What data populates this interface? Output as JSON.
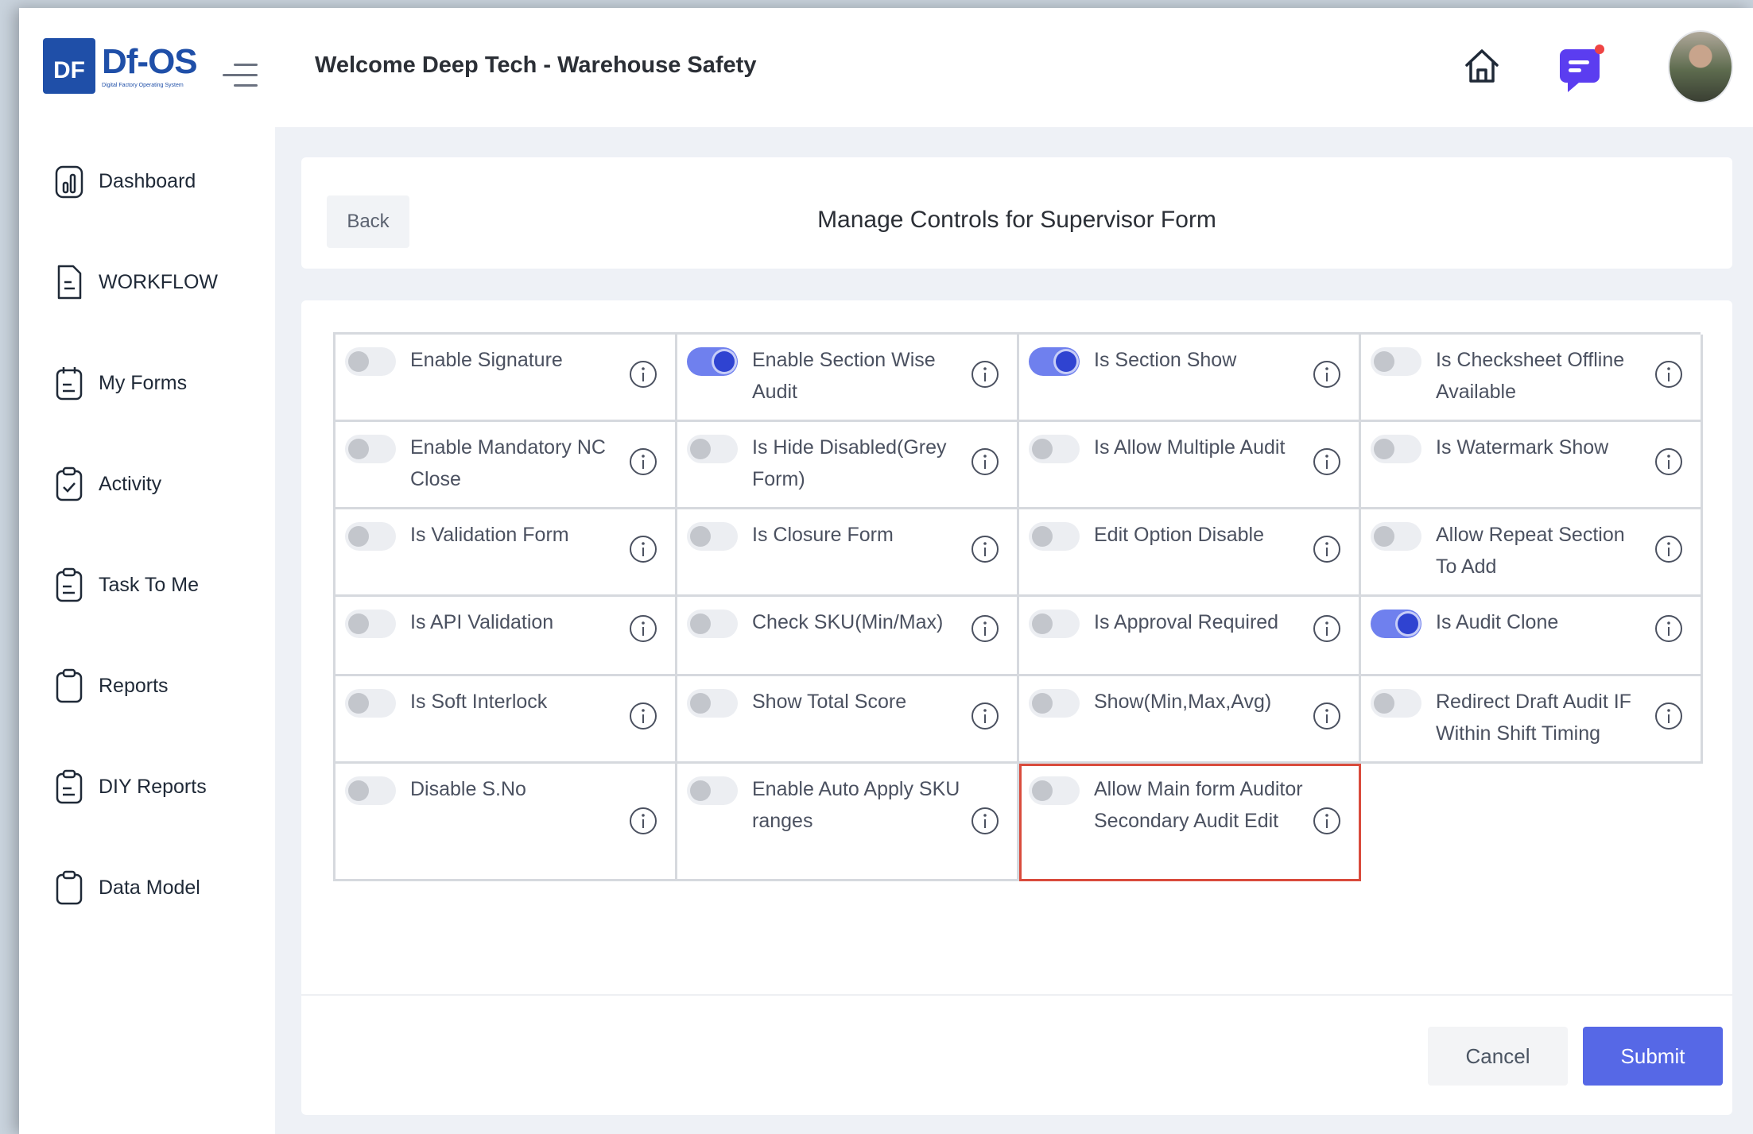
{
  "brand": {
    "logo_mark": "DF",
    "name": "Df-OS",
    "tagline": "Digital Factory Operating System",
    "color": "#1f4fa8"
  },
  "header": {
    "welcome": "Welcome Deep Tech - Warehouse Safety",
    "icons": [
      "home-icon",
      "chat-icon",
      "avatar"
    ],
    "chat_notification_color": "#ef4444"
  },
  "sidebar": {
    "items": [
      {
        "label": "Dashboard",
        "icon": "chart-icon"
      },
      {
        "label": "WORKFLOW",
        "icon": "document-icon"
      },
      {
        "label": "My Forms",
        "icon": "calendar-list-icon"
      },
      {
        "label": "Activity",
        "icon": "clipboard-check-icon"
      },
      {
        "label": "Task To Me",
        "icon": "clipboard-list-icon"
      },
      {
        "label": "Reports",
        "icon": "clipboard-icon"
      },
      {
        "label": "DIY Reports",
        "icon": "clipboard-list-icon"
      },
      {
        "label": "Data Model",
        "icon": "clipboard-icon"
      }
    ]
  },
  "title_card": {
    "back_label": "Back",
    "title": "Manage Controls for Supervisor Form"
  },
  "controls": [
    {
      "label": "Enable Signature",
      "enabled": false
    },
    {
      "label": "Enable Section Wise Audit",
      "enabled": true
    },
    {
      "label": "Is Section Show",
      "enabled": true
    },
    {
      "label": "Is Checksheet Offline Available",
      "enabled": false
    },
    {
      "label": "Enable Mandatory NC Close",
      "enabled": false
    },
    {
      "label": "Is Hide Disabled(Grey Form)",
      "enabled": false
    },
    {
      "label": "Is Allow Multiple Audit",
      "enabled": false
    },
    {
      "label": "Is Watermark Show",
      "enabled": false
    },
    {
      "label": "Is Validation Form",
      "enabled": false
    },
    {
      "label": "Is Closure Form",
      "enabled": false
    },
    {
      "label": "Edit Option Disable",
      "enabled": false
    },
    {
      "label": "Allow Repeat Section To Add",
      "enabled": false
    },
    {
      "label": "Is API Validation",
      "enabled": false
    },
    {
      "label": "Check SKU(Min/Max)",
      "enabled": false
    },
    {
      "label": "Is Approval Required",
      "enabled": false
    },
    {
      "label": "Is Audit Clone",
      "enabled": true
    },
    {
      "label": "Is Soft Interlock",
      "enabled": false
    },
    {
      "label": "Show Total Score",
      "enabled": false
    },
    {
      "label": "Show(Min,Max,Avg)",
      "enabled": false
    },
    {
      "label": "Redirect Draft Audit IF Within Shift Timing",
      "enabled": false
    },
    {
      "label": "Disable S.No",
      "enabled": false
    },
    {
      "label": "Enable Auto Apply SKU ranges",
      "enabled": false
    },
    {
      "label": "Allow Main form Auditor Secondary Audit Edit",
      "enabled": false,
      "highlighted": true
    }
  ],
  "footer": {
    "cancel_label": "Cancel",
    "submit_label": "Submit"
  },
  "colors": {
    "toggle_on": "#2f43d1",
    "toggle_track_on": "#6f80ee",
    "submit": "#5668e6",
    "highlight_border": "#d94b3c"
  }
}
